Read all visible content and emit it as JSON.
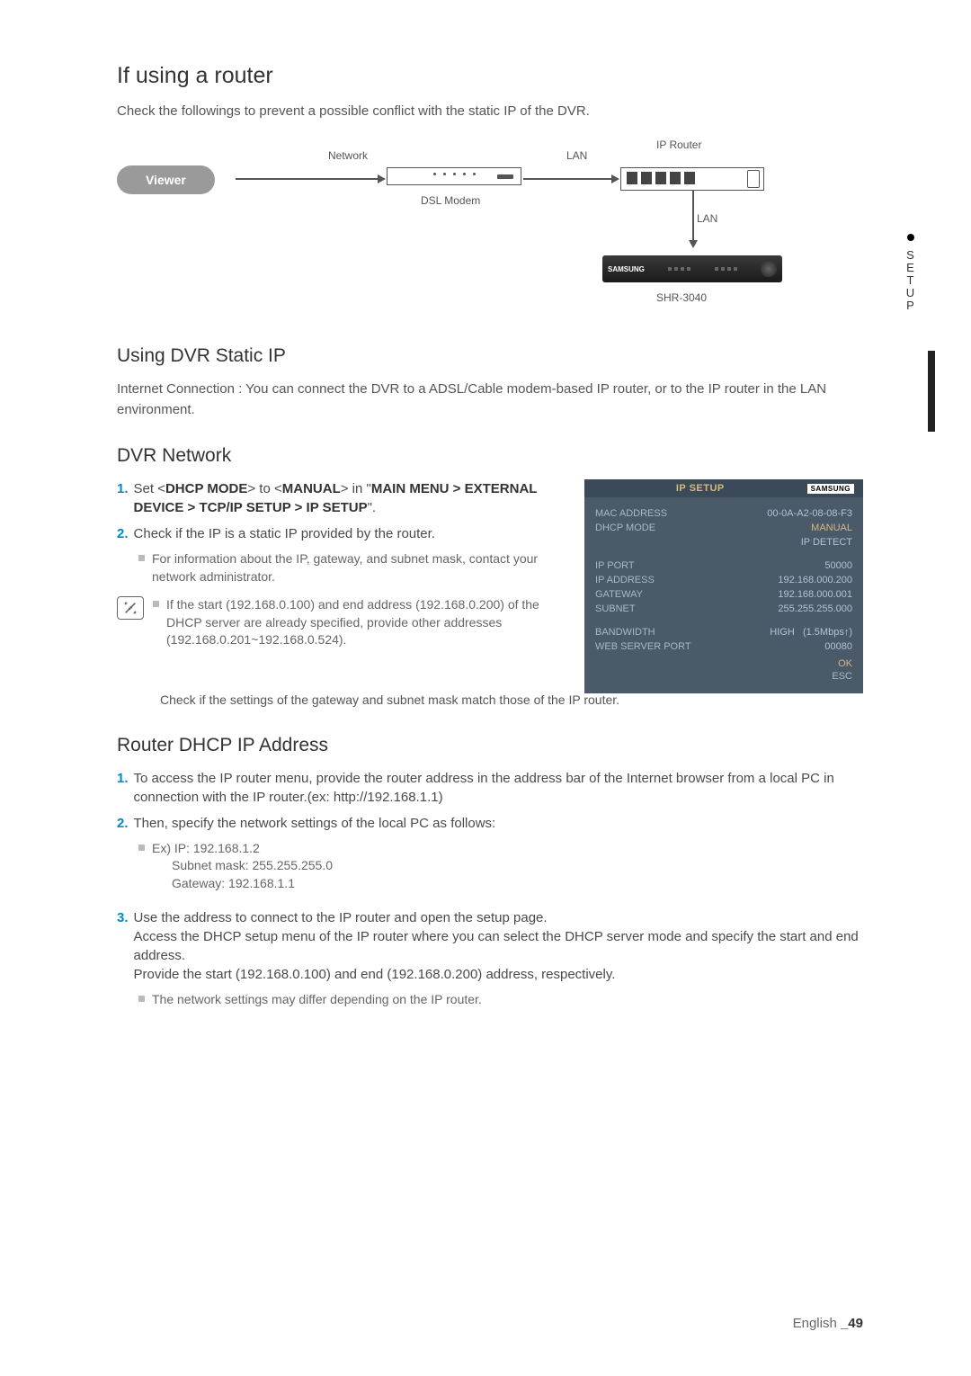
{
  "sideTab": "SETUP",
  "section1": {
    "title": "If using a router",
    "intro": "Check the followings to prevent a possible conflict with the static IP of the DVR."
  },
  "diagram": {
    "viewer": "Viewer",
    "network": "Network",
    "lan": "LAN",
    "iprouter": "IP Router",
    "modem": "DSL Modem",
    "lan2": "LAN",
    "device": "SHR-3040",
    "brand": "SAMSUNG"
  },
  "section2": {
    "title": "Using DVR Static IP",
    "desc": "Internet Connection : You can connect the DVR to a ADSL/Cable modem-based IP router, or to the IP router in the LAN environment."
  },
  "section3": {
    "title": "DVR Network",
    "step1_num": "1.",
    "step1_a": "Set <",
    "step1_b": "DHCP MODE",
    "step1_c": "> to <",
    "step1_d": "MANUAL",
    "step1_e": "> in \"",
    "step1_f": "MAIN MENU > EXTERNAL DEVICE > TCP/IP SETUP > IP SETUP",
    "step1_g": "\".",
    "step2_num": "2.",
    "step2": "Check if the IP is a static IP provided by the router.",
    "step2_b": "For information about the IP, gateway, and subnet mask, contact your network administrator.",
    "note": "If the start (192.168.0.100) and end address (192.168.0.200) of the DHCP server are already specified, provide other addresses (192.168.0.201~192.168.0.524).",
    "noteUnder": "Check if the settings of the gateway and subnet mask match those of the IP router."
  },
  "ipSetup": {
    "title": "IP SETUP",
    "samsung": "SAMSUNG",
    "mac_l": "MAC ADDRESS",
    "mac_v": "00-0A-A2-08-08-F3",
    "dhcp_l": "DHCP MODE",
    "dhcp_v": "MANUAL",
    "detect": "IP DETECT",
    "port_l": "IP PORT",
    "port_v": "50000",
    "addr_l": "IP ADDRESS",
    "addr_v": "192.168.000.200",
    "gw_l": "GATEWAY",
    "gw_v": "192.168.000.001",
    "sub_l": "SUBNET",
    "sub_v": "255.255.255.000",
    "bw_l": "BANDWIDTH",
    "bw_v1": "HIGH",
    "bw_v2": "(1.5Mbps↑)",
    "web_l": "WEB SERVER PORT",
    "web_v": "00080",
    "ok": "OK",
    "esc": "ESC"
  },
  "section4": {
    "title": "Router DHCP IP Address",
    "s1_num": "1.",
    "s1": "To access the IP router menu, provide the router address in the address bar of the Internet browser from a local PC in connection with the IP router.(ex: http://192.168.1.1)",
    "s2_num": "2.",
    "s2": "Then, specify the network settings of the local PC as follows:",
    "s2_b1": "Ex) IP: 192.168.1.2",
    "s2_b2": "Subnet mask: 255.255.255.0",
    "s2_b3": "Gateway: 192.168.1.1",
    "s3_num": "3.",
    "s3a": "Use the address to connect to the IP router and open the setup page.",
    "s3b": "Access the DHCP setup menu of the IP router where you can select the DHCP server mode and specify the start and end address.",
    "s3c": "Provide the start (192.168.0.100) and end (192.168.0.200) address, respectively.",
    "s3_b": "The network settings may differ depending on the IP router."
  },
  "footer": {
    "lang": "English ",
    "page": "_49"
  }
}
